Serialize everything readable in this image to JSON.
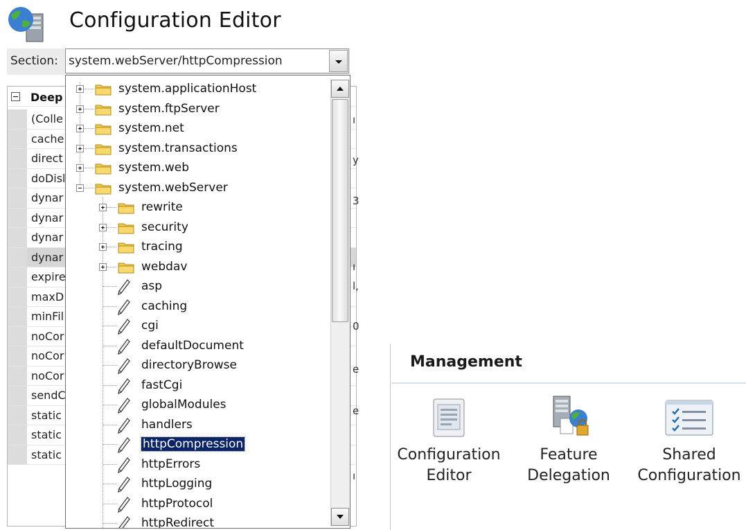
{
  "header": {
    "title": "Configuration Editor"
  },
  "section": {
    "label": "Section:",
    "value": "system.webServer/httpCompression"
  },
  "grid": {
    "group_label": "Deep",
    "rows": [
      "(Colle",
      "cache",
      "direct",
      "doDisl",
      "dynar",
      "dynar",
      "dynar",
      "dynar",
      "expire",
      "maxD",
      "minFil",
      "noCor",
      "noCor",
      "noCor",
      "sendC",
      "static",
      "static",
      "static"
    ],
    "highlighted_index": 7
  },
  "tree": {
    "top_level": [
      {
        "label": "system.applicationHost",
        "expanded": false
      },
      {
        "label": "system.ftpServer",
        "expanded": false
      },
      {
        "label": "system.net",
        "expanded": false
      },
      {
        "label": "system.transactions",
        "expanded": false
      },
      {
        "label": "system.web",
        "expanded": false
      },
      {
        "label": "system.webServer",
        "expanded": true
      }
    ],
    "child_folders": [
      "rewrite",
      "security",
      "tracing",
      "webdav"
    ],
    "child_sections": [
      "asp",
      "caching",
      "cgi",
      "defaultDocument",
      "directoryBrowse",
      "fastCgi",
      "globalModules",
      "handlers",
      "httpCompression",
      "httpErrors",
      "httpLogging",
      "httpProtocol",
      "httpRedirect"
    ],
    "selected": "httpCompression"
  },
  "management": {
    "title": "Management",
    "items": [
      {
        "label_line1": "Configuration",
        "label_line2": "Editor",
        "icon": "config-editor-icon"
      },
      {
        "label_line1": "Feature",
        "label_line2": "Delegation",
        "icon": "feature-delegation-icon"
      },
      {
        "label_line1": "Shared",
        "label_line2": "Configuration",
        "icon": "shared-configuration-icon"
      }
    ]
  },
  "colors": {
    "selection": "#0a246a",
    "folder": "#f2c94c",
    "rule": "#d6e2ef"
  }
}
